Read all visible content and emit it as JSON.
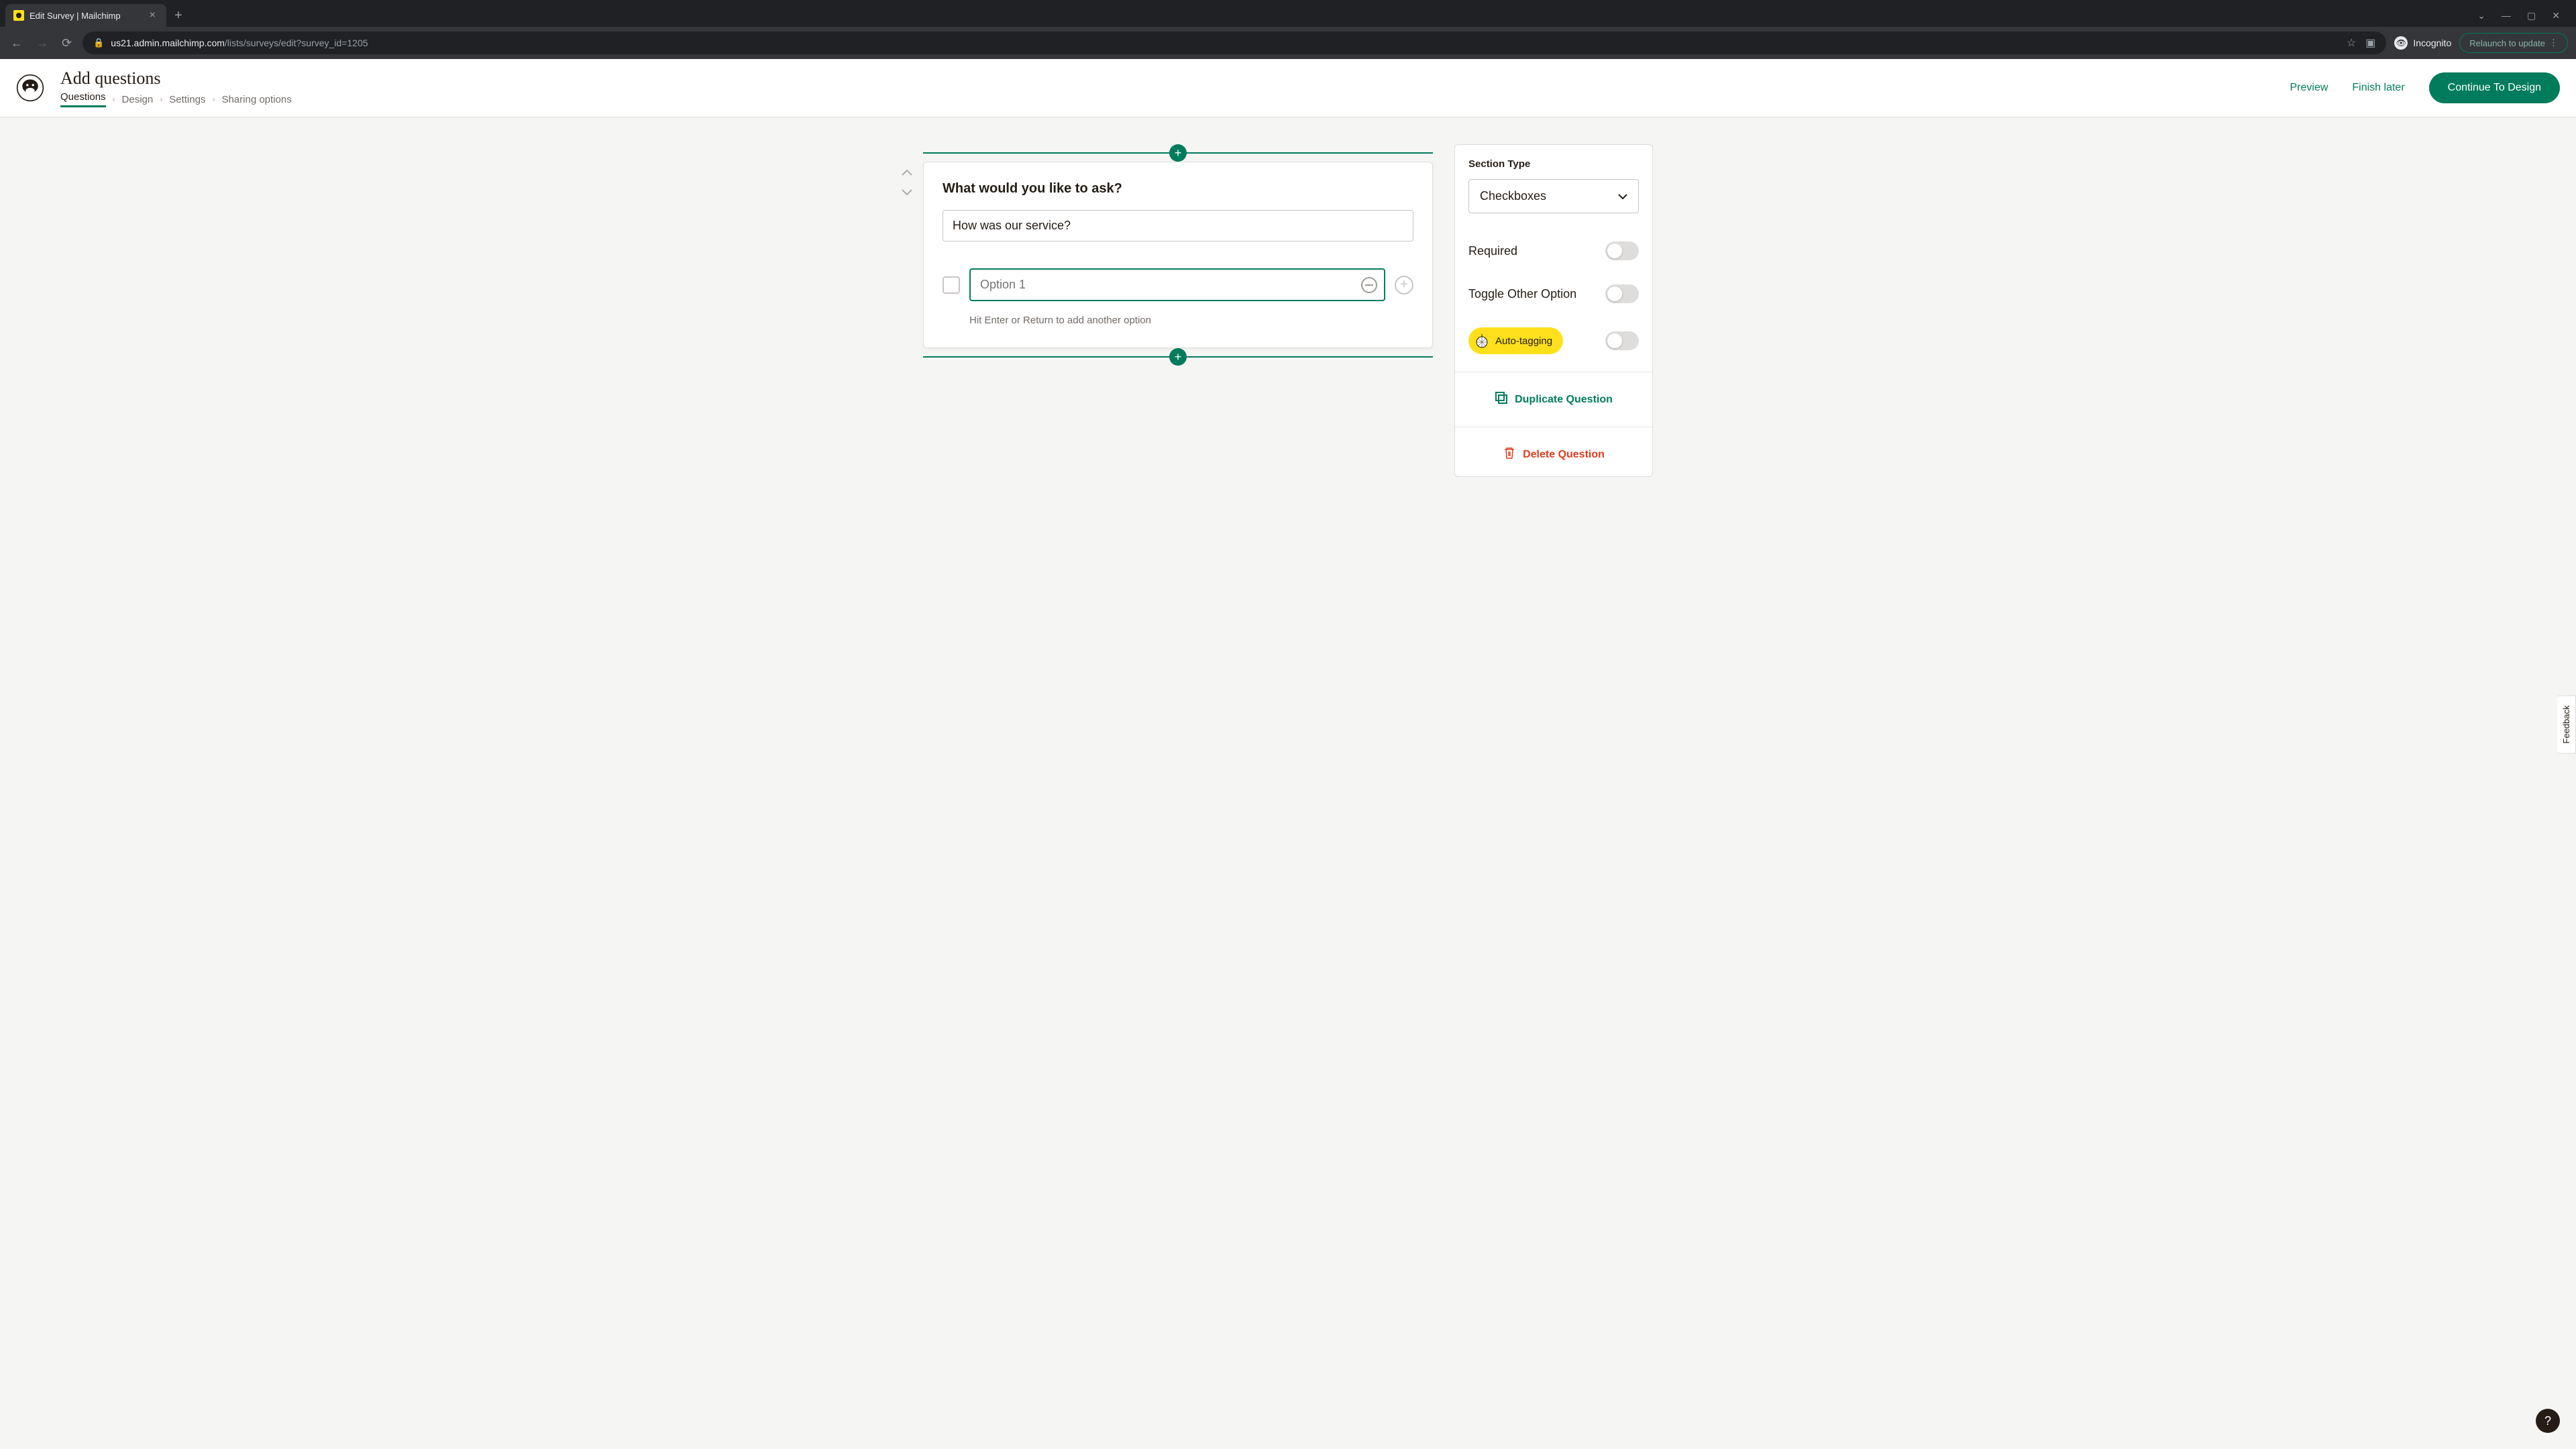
{
  "browser": {
    "tab_title": "Edit Survey | Mailchimp",
    "url_domain": "us21.admin.mailchimp.com",
    "url_path": "/lists/surveys/edit?survey_id=1205",
    "incognito_label": "Incognito",
    "relaunch_label": "Relaunch to update"
  },
  "header": {
    "title": "Add questions",
    "breadcrumb": {
      "items": [
        "Questions",
        "Design",
        "Settings",
        "Sharing options"
      ],
      "active_index": 0
    },
    "actions": {
      "preview": "Preview",
      "finish_later": "Finish later",
      "continue": "Continue To Design"
    }
  },
  "question": {
    "prompt_label": "What would you like to ask?",
    "question_value": "How was our service?",
    "option_placeholder": "Option 1",
    "hint": "Hit Enter or Return to add another option"
  },
  "config": {
    "section_type_label": "Section Type",
    "section_type_value": "Checkboxes",
    "required_label": "Required",
    "toggle_other_label": "Toggle Other Option",
    "auto_tagging_label": "Auto-tagging",
    "duplicate_label": "Duplicate Question",
    "delete_label": "Delete Question"
  },
  "feedback_label": "Feedback",
  "help_label": "?"
}
